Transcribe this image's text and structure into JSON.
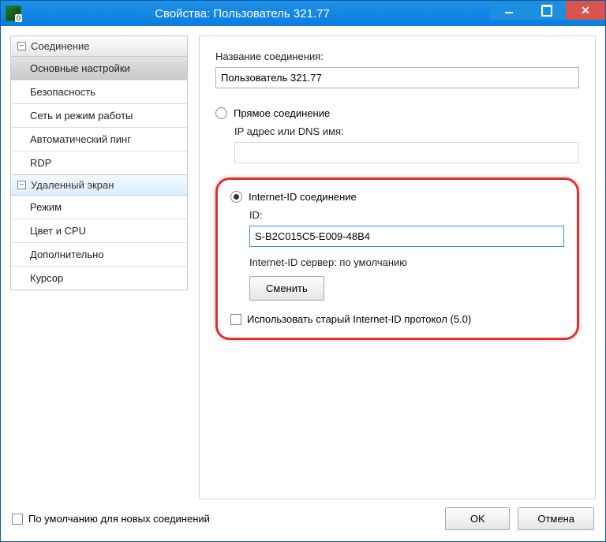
{
  "window": {
    "title": "Свойства: Пользователь 321.77"
  },
  "sidebar": {
    "groups": [
      {
        "label": "Соединение",
        "items": [
          "Основные настройки",
          "Безопасность",
          "Сеть и режим работы",
          "Автоматический пинг",
          "RDP"
        ],
        "activeIndex": 0
      },
      {
        "label": "Удаленный экран",
        "items": [
          "Режим",
          "Цвет и CPU",
          "Дополнительно",
          "Курсор"
        ]
      }
    ]
  },
  "main": {
    "connNameLabel": "Название соединения:",
    "connNameValue": "Пользователь 321.77",
    "directConnLabel": "Прямое соединение",
    "ipLabel": "IP адрес или DNS имя:",
    "ipValue": "",
    "internetIdLabel": "Internet-ID соединение",
    "idFieldLabel": "ID:",
    "idValue": "S-B2C015C5-E009-48B4",
    "serverLabel": "Internet-ID сервер: по умолчанию",
    "changeBtn": "Сменить",
    "oldProtoLabel": "Использовать старый Internet-ID протокол (5.0)"
  },
  "footer": {
    "defaultLabel": "По умолчанию для новых соединений",
    "ok": "OK",
    "cancel": "Отмена"
  }
}
